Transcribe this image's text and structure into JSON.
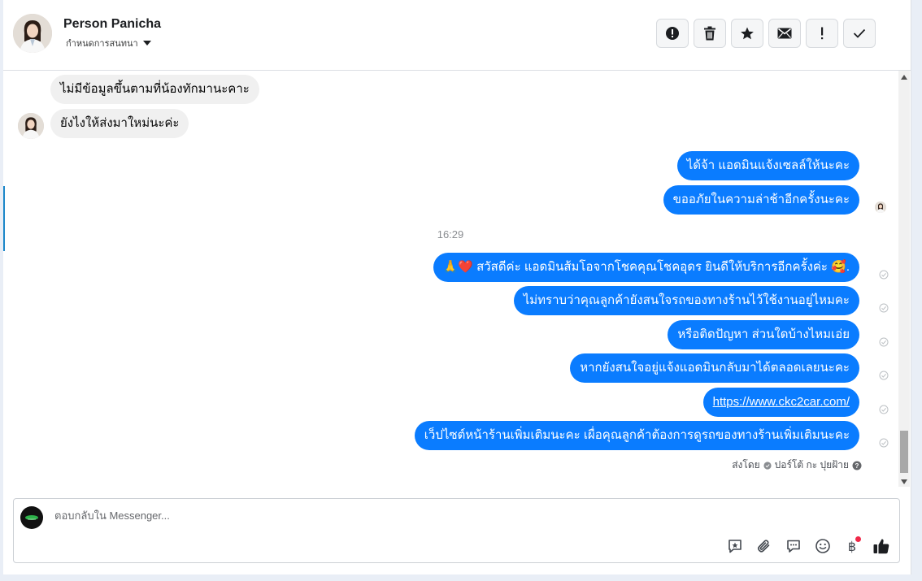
{
  "header": {
    "contact_name": "Person Panicha",
    "assign_label": "กำหนดการสนทนา"
  },
  "actions": [
    {
      "icon": "alert-circle-icon"
    },
    {
      "icon": "trash-icon"
    },
    {
      "icon": "star-icon"
    },
    {
      "icon": "envelope-icon"
    },
    {
      "icon": "exclamation-icon"
    },
    {
      "icon": "check-icon"
    }
  ],
  "messages": {
    "incoming": [
      "ไม่มีข้อมูลขึ้นตามที่น้องทักมานะคาะ",
      "ยังไงให้ส่งมาใหม่นะค่ะ"
    ],
    "outgoing_before": [
      "ได้จ้า แอดมินแจ้งเซลล์ให้นะคะ",
      "ขออภัยในความล่าช้าอีกครั้งนะคะ"
    ],
    "timestamp": "16:29",
    "outgoing_after": [
      "🙏❤️ สวัสดีค่ะ แอดมินส้มโอจากโชคคุณโชคอุดร ยินดีให้บริการอีกครั้งค่ะ 🥰.",
      "ไม่ทราบว่าคุณลูกค้ายังสนใจรถของทางร้านไว้ใช้งานอยู่ไหมคะ",
      "หรือติดปัญหา ส่วนใดบ้างไหมเอ่ย",
      "หากยังสนใจอยู่แจ้งแอดมินกลับมาได้ตลอดเลยนะคะ",
      "https://www.ckc2car.com/",
      "เว็ปไซต์หน้าร้านเพิ่มเติมนะคะ เผื่อคุณลูกค้าต้องการดูรถของทางร้านเพิ่มเติมนะคะ"
    ],
    "sent_by_prefix": "ส่งโดย",
    "sent_by_name": "ปอร์โต้ กะ ปุยฝ้าย"
  },
  "composer": {
    "placeholder": "ตอบกลับใน Messenger..."
  },
  "colors": {
    "outgoing_bubble": "#0a7cff",
    "incoming_bubble": "#f0f0f0",
    "notification_dot": "#f02849"
  }
}
